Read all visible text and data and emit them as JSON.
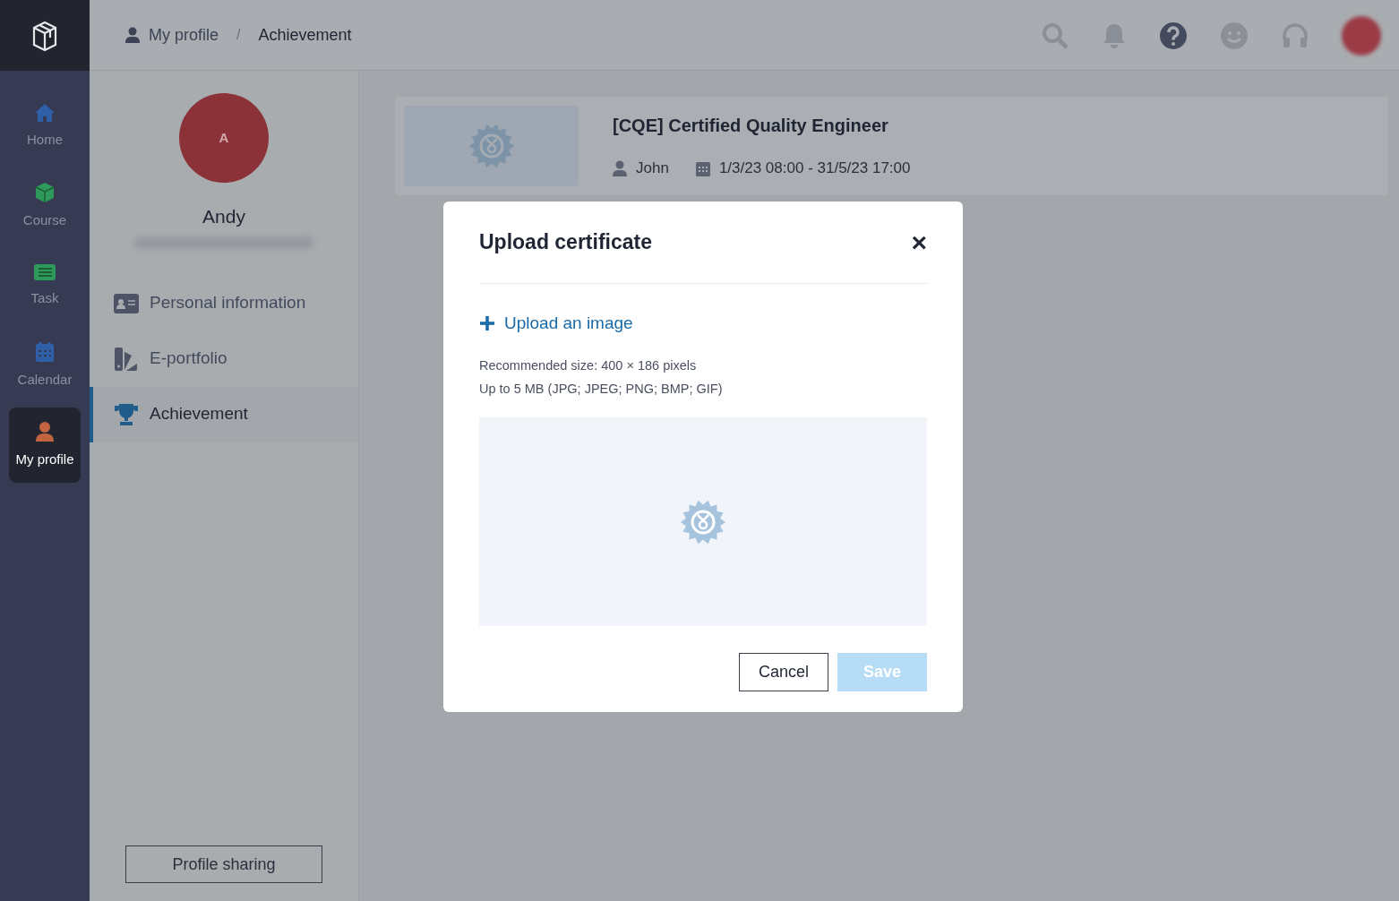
{
  "nav": {
    "items": [
      {
        "label": "Home",
        "selected": false
      },
      {
        "label": "Course",
        "selected": false
      },
      {
        "label": "Task",
        "selected": false
      },
      {
        "label": "Calendar",
        "selected": false
      },
      {
        "label": "My profile",
        "selected": true
      }
    ]
  },
  "breadcrumb": {
    "items": [
      "My profile",
      "Achievement"
    ],
    "separator": "/"
  },
  "profile": {
    "initial": "A",
    "name": "Andy",
    "menu": [
      {
        "label": "Personal information",
        "selected": false
      },
      {
        "label": "E-portfolio",
        "selected": false
      },
      {
        "label": "Achievement",
        "selected": true
      }
    ],
    "share_button": "Profile sharing"
  },
  "achievements": [
    {
      "title": "[CQE] Certified Quality Engineer",
      "person": "John",
      "dates": "1/3/23 08:00 - 31/5/23 17:00"
    }
  ],
  "dialog": {
    "title": "Upload certificate",
    "close": "×",
    "upload_link": "Upload an image",
    "hints": [
      "Recommended size: 400 × 186 pixels",
      "Up to 5 MB (JPG; JPEG; PNG; BMP; GIF)"
    ],
    "buttons": [
      {
        "label": "Cancel",
        "kind": "secondary",
        "disabled": false
      },
      {
        "label": "Save",
        "kind": "primary",
        "disabled": true
      }
    ]
  }
}
